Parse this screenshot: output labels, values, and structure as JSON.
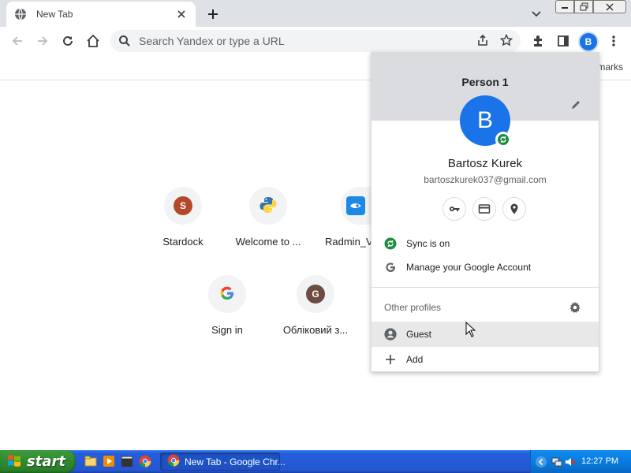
{
  "browser": {
    "tab_title": "New Tab",
    "omnibox_placeholder": "Search Yandex or type a URL",
    "avatar_letter": "B",
    "bookmarks_text": "marks"
  },
  "shortcuts": [
    {
      "label": "Stardock",
      "letter": "S",
      "color": "#b5472a"
    },
    {
      "label": "Welcome to ...",
      "letter": "",
      "color": "#3776ab"
    },
    {
      "label": "Radmin_V",
      "letter": "",
      "color": "#1e88e5"
    },
    {
      "label": "Sign in",
      "letter": "G",
      "color": "#4285f4"
    },
    {
      "label": "Обліковий з...",
      "letter": "G",
      "color": "#6d4c41"
    }
  ],
  "profile_menu": {
    "title": "Person 1",
    "avatar_letter": "B",
    "name": "Bartosz Kurek",
    "email": "bartoszkurek037@gmail.com",
    "sync_label": "Sync is on",
    "manage_label": "Manage your Google Account",
    "other_profiles_label": "Other profiles",
    "guest_label": "Guest",
    "add_label": "Add"
  },
  "taskbar": {
    "start_label": "start",
    "task_label": "New Tab - Google Chr...",
    "clock": "12:27 PM"
  },
  "colors": {
    "accent": "#1a73e8",
    "sync_green": "#1e8e3e",
    "taskbar_blue": "#245edb",
    "start_green": "#2f8a2f"
  }
}
